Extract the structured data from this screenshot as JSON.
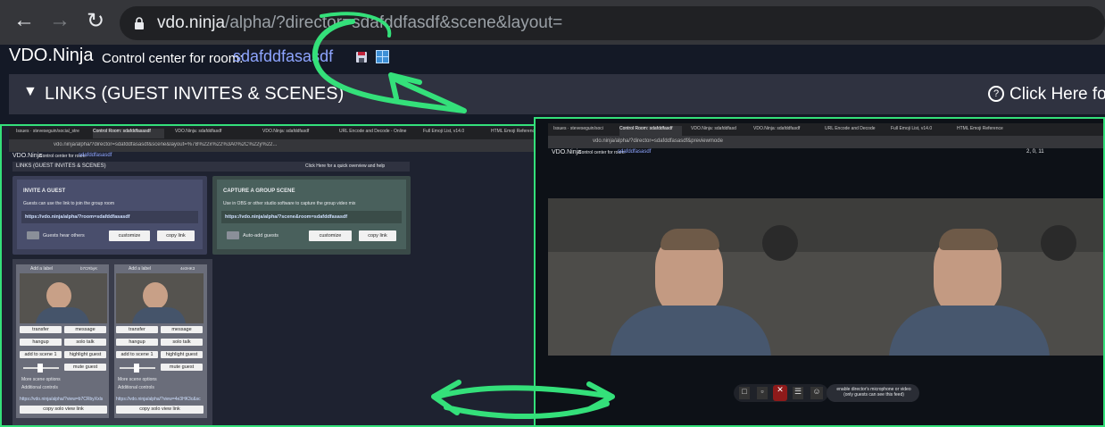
{
  "browser": {
    "url_host": "vdo.ninja",
    "url_path": "/alpha/?director=sdafddfasdf&scene&layout="
  },
  "header": {
    "app_title": "VDO.Ninja",
    "control_label": "Control center for room:",
    "room_name": "sdafddfasasdf"
  },
  "links_bar": {
    "label": "LINKS (GUEST INVITES & SCENES)",
    "help": "Click Here fo"
  },
  "left_screenshot": {
    "tabs": [
      "Issues · steveseguin/social_stre",
      "Control Room: sdafddfasasdf",
      "VDO.Ninja: sdafddfasdf",
      "VDO.Ninja: sdafddfasdf",
      "URL Encode and Decode - Online",
      "Full Emoji List, v14.0",
      "HTML Emoji Reference"
    ],
    "url": "vdo.ninja/alpha/?director=sdafddfasasdf&scene&layout=%7B%22x%22%3A0%2C%22y%22...",
    "app_title": "VDO.Ninja",
    "control_label": "Control center for room:",
    "room_name": "sdafddfasasdf",
    "links_label": "LINKS (GUEST INVITES & SCENES)",
    "help": "Click Here for a quick overview and help",
    "invite": {
      "title": "INVITE A GUEST",
      "desc": "Guests can use the link to join the group room",
      "link": "https://vdo.ninja/alpha/?room=sdafddfasasdf",
      "toggle": "Guests hear others",
      "customize": "customize",
      "copy": "copy link"
    },
    "scene": {
      "title": "CAPTURE A GROUP SCENE",
      "desc": "Use in OBS or other studio software to capture the group video mix",
      "link": "https://vdo.ninja/alpha/?scene&room=sdafddfasasdf",
      "toggle": "Auto-add guests",
      "customize": "customize",
      "copy": "copy link"
    },
    "guests": [
      {
        "label": "Add a label",
        "id": "b7CRbyK",
        "buttons": [
          "transfer",
          "message",
          "hangup",
          "solo talk",
          "add to scene 1",
          "highlight guest",
          "mute guest"
        ],
        "more": "More scene options",
        "additional": "Additional controls",
        "view_link": "https://vdo.ninja/alpha/?view=b7CRbyXxls",
        "copy_solo": "copy solo view link"
      },
      {
        "label": "Add a label",
        "id": "4e3HK3",
        "buttons": [
          "transfer",
          "message",
          "hangup",
          "solo talk",
          "add to scene 1",
          "highlight guest",
          "mute guest"
        ],
        "more": "More scene options",
        "additional": "Additional controls",
        "view_link": "https://vdo.ninja/alpha/?view=4e3HK3c&sc",
        "copy_solo": "copy solo view link"
      }
    ]
  },
  "right_screenshot": {
    "tabs": [
      "Issues · steveseguin/soci",
      "Control Room: sdafddfasdf",
      "VDO.Ninja: sdafddfasd",
      "VDO.Ninja: sdafddfasdf",
      "URL Encode and Decode",
      "Full Emoji List, v14.0",
      "HTML Emoji Reference"
    ],
    "url": "vdo.ninja/alpha/?director=sdafddfasasdf&previewmode",
    "app_title": "VDO.Ninja",
    "control_label": "Control center for room:",
    "room_name": "sdafddfasasdf",
    "stats": "2,  0,  11",
    "enable_notice": "enable director's microphone or video (only guests can see this feed)"
  },
  "colors": {
    "annotation": "#34e07a",
    "room_name": "#8ea5ff"
  }
}
